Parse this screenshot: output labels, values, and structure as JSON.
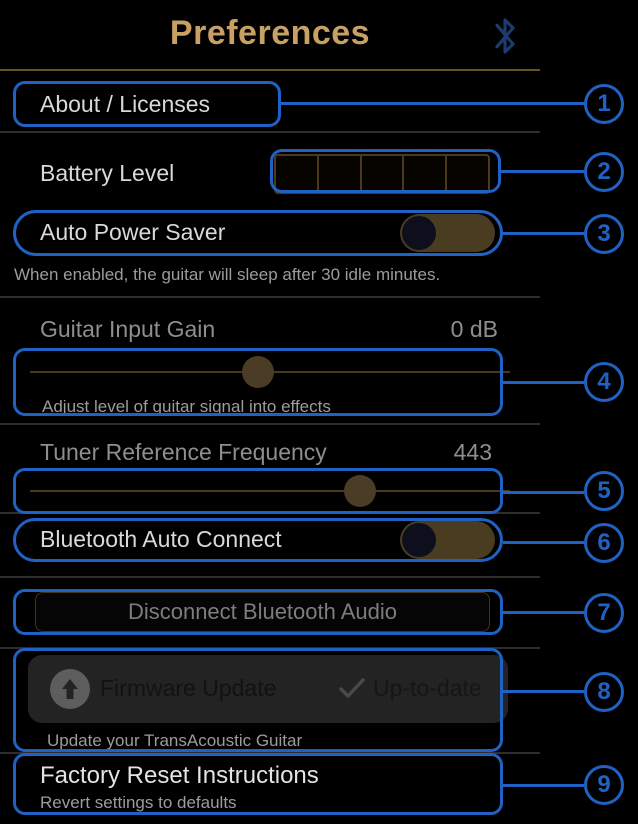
{
  "header": {
    "title": "Preferences",
    "bluetooth_icon": "bluetooth-icon",
    "accent_color": "#c9a063",
    "bluetooth_color": "#1e3a6e"
  },
  "rows": {
    "about": {
      "label": "About / Licenses"
    },
    "battery": {
      "label": "Battery Level",
      "segments": 5,
      "filled": 0
    },
    "auto_power_saver": {
      "label": "Auto Power Saver",
      "state": "off",
      "description": "When enabled, the guitar will sleep after 30 idle minutes."
    },
    "guitar_input_gain": {
      "label": "Guitar Input Gain",
      "value": "0 dB",
      "slider_percent": 50,
      "description": "Adjust level of guitar signal into effects"
    },
    "tuner_reference_frequency": {
      "label": "Tuner Reference Frequency",
      "value": "443",
      "slider_percent": 70
    },
    "bluetooth_auto_connect": {
      "label": "Bluetooth Auto Connect",
      "state": "off"
    },
    "disconnect": {
      "label": "Disconnect Bluetooth Audio",
      "enabled": false
    },
    "firmware": {
      "label": "Firmware Update",
      "status": "Up-to-date",
      "status_icon": "check-icon",
      "icon": "upload-arrow-icon",
      "description": "Update your TransAcoustic Guitar"
    },
    "factory_reset": {
      "label": "Factory Reset Instructions",
      "description": "Revert settings to defaults"
    }
  },
  "annotations": {
    "color": "#1f62c4",
    "markers": [
      {
        "number": "1"
      },
      {
        "number": "2"
      },
      {
        "number": "3"
      },
      {
        "number": "4"
      },
      {
        "number": "5"
      },
      {
        "number": "6"
      },
      {
        "number": "7"
      },
      {
        "number": "8"
      },
      {
        "number": "9"
      }
    ]
  }
}
